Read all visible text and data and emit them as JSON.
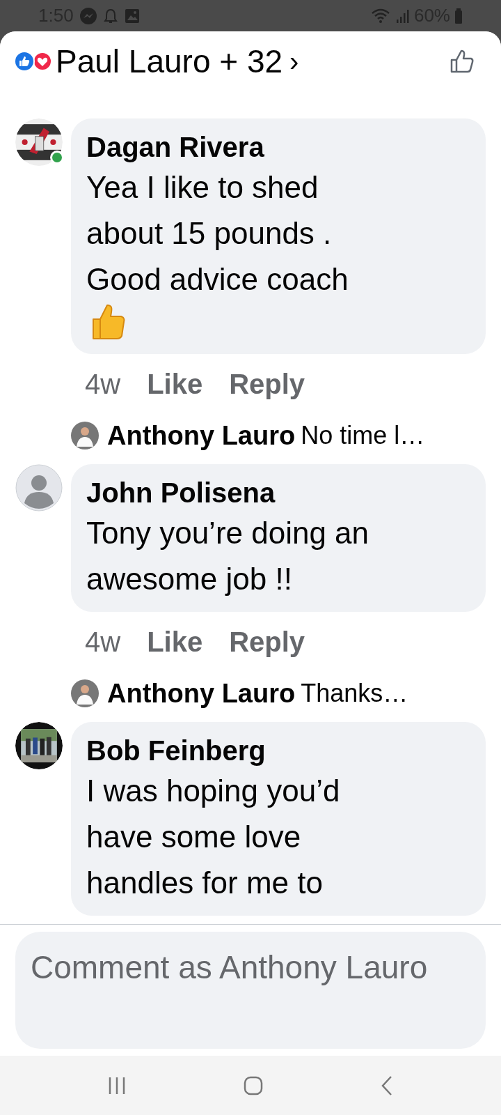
{
  "status_bar": {
    "time": "1:50",
    "battery": "60%"
  },
  "header": {
    "title": "Paul Lauro + 32",
    "chevron": "›"
  },
  "comments": [
    {
      "author": "Dagan Rivera",
      "online": true,
      "text": "Yea I like to shed about 15 pounds . Good advice coach",
      "thumbs_emoji": true,
      "time": "4w",
      "like": "Like",
      "reply": "Reply",
      "reply_preview": {
        "author": "Anthony Lauro",
        "text": "No time l…"
      }
    },
    {
      "author": "John Polisena",
      "avatar": {
        "kind": "default"
      },
      "online": false,
      "text": "Tony you’re doing an awesome job !!",
      "thumbs_emoji": false,
      "time": "4w",
      "like": "Like",
      "reply": "Reply",
      "reply_preview": {
        "author": "Anthony Lauro",
        "text": "Thanks…"
      }
    },
    {
      "author": "Bob Feinberg",
      "online": false,
      "text": "I was hoping you’d have some love handles for me to",
      "thumbs_emoji": false
    }
  ],
  "composer": {
    "placeholder": "Comment as Anthony Lauro"
  }
}
